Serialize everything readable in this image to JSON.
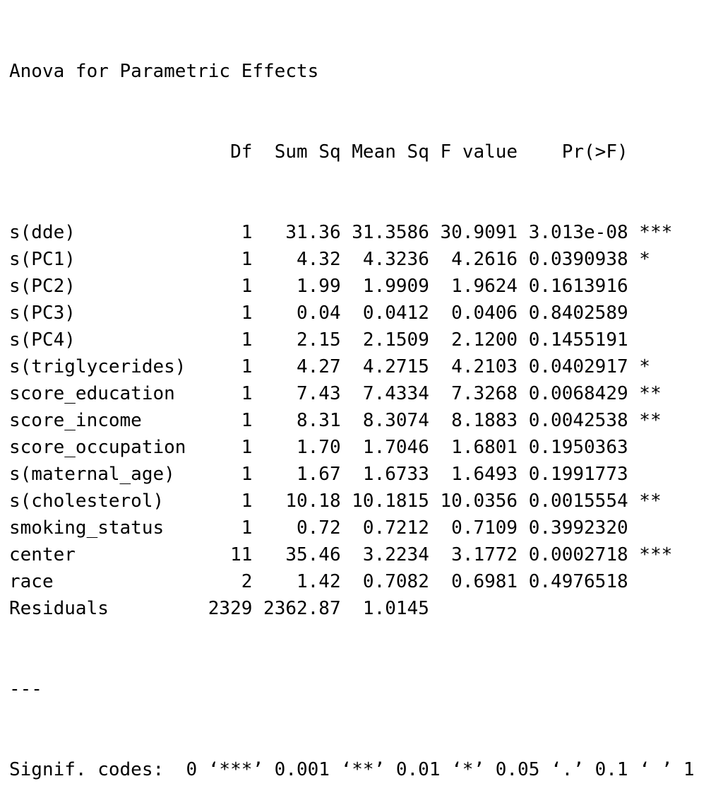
{
  "title": "Anova for Parametric Effects",
  "table": {
    "columns": [
      "Df",
      "Sum Sq",
      "Mean Sq",
      "F value",
      "Pr(>F)"
    ],
    "rows": [
      {
        "term": "s(dde)",
        "df": "1",
        "sum_sq": "31.36",
        "mean_sq": "31.3586",
        "f_value": "30.9091",
        "p_value": "3.013e-08",
        "signif": "***"
      },
      {
        "term": "s(PC1)",
        "df": "1",
        "sum_sq": "4.32",
        "mean_sq": "4.3236",
        "f_value": "4.2616",
        "p_value": "0.0390938",
        "signif": "*"
      },
      {
        "term": "s(PC2)",
        "df": "1",
        "sum_sq": "1.99",
        "mean_sq": "1.9909",
        "f_value": "1.9624",
        "p_value": "0.1613916",
        "signif": ""
      },
      {
        "term": "s(PC3)",
        "df": "1",
        "sum_sq": "0.04",
        "mean_sq": "0.0412",
        "f_value": "0.0406",
        "p_value": "0.8402589",
        "signif": ""
      },
      {
        "term": "s(PC4)",
        "df": "1",
        "sum_sq": "2.15",
        "mean_sq": "2.1509",
        "f_value": "2.1200",
        "p_value": "0.1455191",
        "signif": ""
      },
      {
        "term": "s(triglycerides)",
        "df": "1",
        "sum_sq": "4.27",
        "mean_sq": "4.2715",
        "f_value": "4.2103",
        "p_value": "0.0402917",
        "signif": "*"
      },
      {
        "term": "score_education",
        "df": "1",
        "sum_sq": "7.43",
        "mean_sq": "7.4334",
        "f_value": "7.3268",
        "p_value": "0.0068429",
        "signif": "**"
      },
      {
        "term": "score_income",
        "df": "1",
        "sum_sq": "8.31",
        "mean_sq": "8.3074",
        "f_value": "8.1883",
        "p_value": "0.0042538",
        "signif": "**"
      },
      {
        "term": "score_occupation",
        "df": "1",
        "sum_sq": "1.70",
        "mean_sq": "1.7046",
        "f_value": "1.6801",
        "p_value": "0.1950363",
        "signif": ""
      },
      {
        "term": "s(maternal_age)",
        "df": "1",
        "sum_sq": "1.67",
        "mean_sq": "1.6733",
        "f_value": "1.6493",
        "p_value": "0.1991773",
        "signif": ""
      },
      {
        "term": "s(cholesterol)",
        "df": "1",
        "sum_sq": "10.18",
        "mean_sq": "10.1815",
        "f_value": "10.0356",
        "p_value": "0.0015554",
        "signif": "**"
      },
      {
        "term": "smoking_status",
        "df": "1",
        "sum_sq": "0.72",
        "mean_sq": "0.7212",
        "f_value": "0.7109",
        "p_value": "0.3992320",
        "signif": ""
      },
      {
        "term": "center",
        "df": "11",
        "sum_sq": "35.46",
        "mean_sq": "3.2234",
        "f_value": "3.1772",
        "p_value": "0.0002718",
        "signif": "***"
      },
      {
        "term": "race",
        "df": "2",
        "sum_sq": "1.42",
        "mean_sq": "0.7082",
        "f_value": "0.6981",
        "p_value": "0.4976518",
        "signif": ""
      },
      {
        "term": "Residuals",
        "df": "2329",
        "sum_sq": "2362.87",
        "mean_sq": "1.0145",
        "f_value": "",
        "p_value": "",
        "signif": ""
      }
    ]
  },
  "separator": "---",
  "signif_codes": "Signif. codes:  0 ‘***’ 0.001 ‘**’ 0.01 ‘*’ 0.05 ‘.’ 0.1 ‘ ’ 1"
}
